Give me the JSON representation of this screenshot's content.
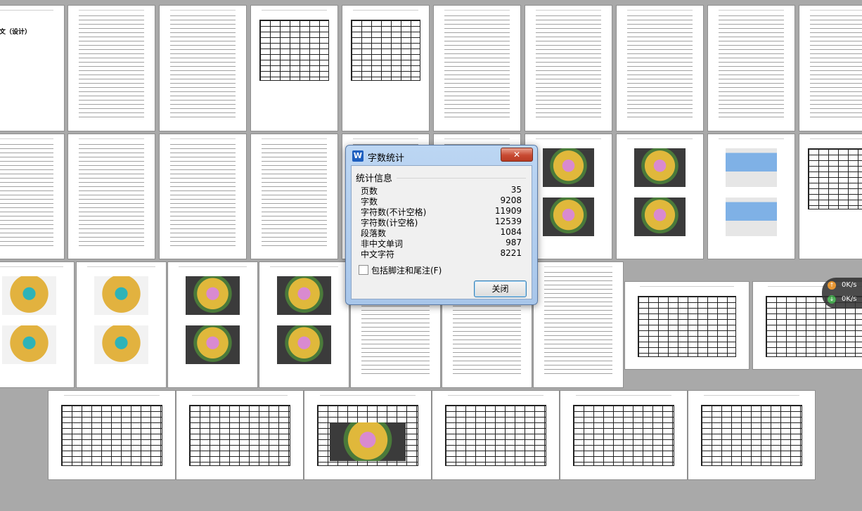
{
  "thumbnail_page_title": "毕业论文（设计）",
  "dialog": {
    "title": "字数统计",
    "group_title": "统计信息",
    "stats": [
      {
        "label": "页数",
        "value": "35"
      },
      {
        "label": "字数",
        "value": "9208"
      },
      {
        "label": "字符数(不计空格)",
        "value": "11909"
      },
      {
        "label": "字符数(计空格)",
        "value": "12539"
      },
      {
        "label": "段落数",
        "value": "1084"
      },
      {
        "label": "非中文单词",
        "value": "987"
      },
      {
        "label": "中文字符",
        "value": "8221"
      }
    ],
    "checkbox_label": "包括脚注和尾注(F)",
    "checkbox_checked": false,
    "close_button": "关闭"
  },
  "network_speed": {
    "upload": "0K/s",
    "download": "0K/s"
  }
}
